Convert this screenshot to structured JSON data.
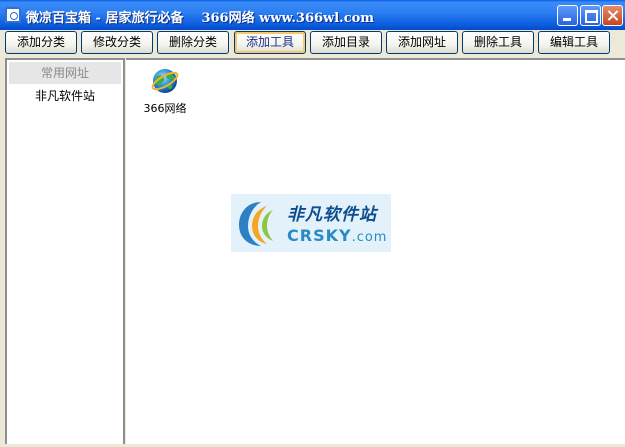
{
  "window": {
    "title": "微凉百宝箱 - 居家旅行必备",
    "title_extra": "366网络 www.366wl.com"
  },
  "toolbar": {
    "buttons": [
      {
        "label": "添加分类"
      },
      {
        "label": "修改分类"
      },
      {
        "label": "删除分类"
      },
      {
        "label": "添加工具"
      },
      {
        "label": "添加目录"
      },
      {
        "label": "添加网址"
      },
      {
        "label": "删除工具"
      },
      {
        "label": "编辑工具"
      }
    ]
  },
  "sidebar": {
    "header": "常用网址",
    "items": [
      {
        "label": "非凡软件站"
      }
    ]
  },
  "tools": [
    {
      "label": "366网络",
      "icon": "globe-icon"
    }
  ],
  "watermark": {
    "cn": "非凡软件站",
    "en": "CRSKY",
    "domain": ".com"
  },
  "colors": {
    "titlebar": "#2D7FF2",
    "face": "#ECE9D8",
    "button_border": "#003C74",
    "active_highlight": "#F9C66F"
  }
}
